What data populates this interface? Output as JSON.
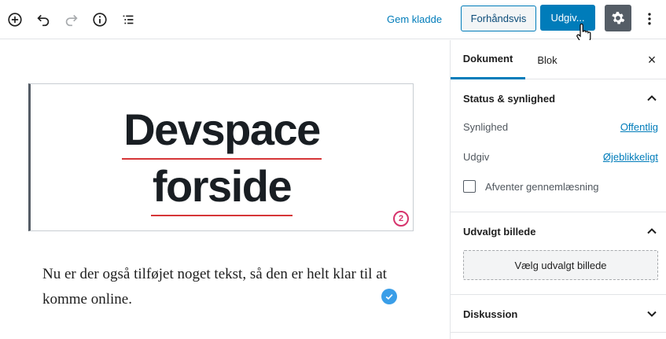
{
  "toolbar": {
    "save_draft": "Gem kladde",
    "preview": "Forhåndsvis",
    "publish": "Udgiv..."
  },
  "colors": {
    "primary": "#007cba",
    "settings_bg": "#555d66",
    "spell_underline": "#d63638",
    "grammar_badge": "#d6336c",
    "check_badge": "#3a9ee8"
  },
  "editor": {
    "heading_line1": "Devspace",
    "heading_line2": "forside",
    "grammar_count": "2",
    "paragraph": "Nu er der også tilføjet noget tekst, så den er helt klar til at komme online."
  },
  "sidebar": {
    "tabs": {
      "document": "Dokument",
      "block": "Blok"
    },
    "close": "×",
    "status": {
      "title": "Status & synlighed",
      "visibility_label": "Synlighed",
      "visibility_value": "Offentlig",
      "publish_label": "Udgiv",
      "publish_value": "Øjeblikkeligt",
      "pending_review": "Afventer gennemlæsning"
    },
    "featured_image": {
      "title": "Udvalgt billede",
      "button": "Vælg udvalgt billede"
    },
    "discussion": {
      "title": "Diskussion"
    }
  },
  "icons": [
    "add-block-icon",
    "undo-icon",
    "redo-icon",
    "info-icon",
    "outline-icon",
    "gear-icon",
    "more-vertical-icon",
    "chevron-up-icon",
    "chevron-down-icon",
    "close-icon",
    "hand-cursor-icon"
  ]
}
